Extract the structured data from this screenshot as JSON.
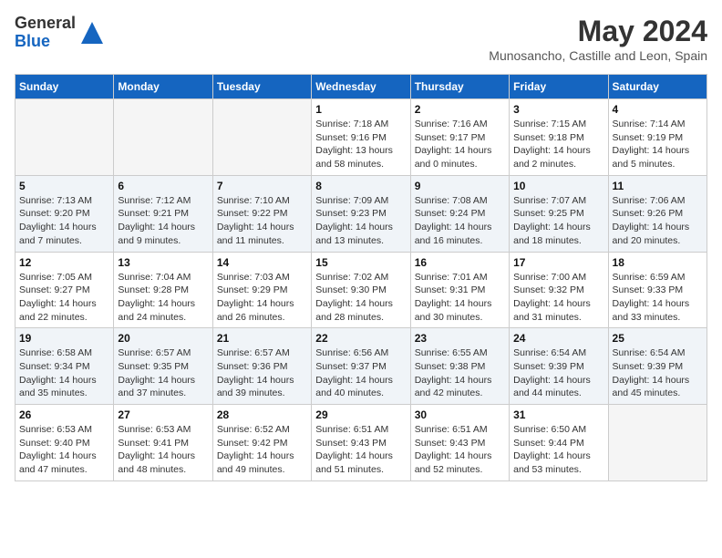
{
  "header": {
    "logo_general": "General",
    "logo_blue": "Blue",
    "month_year": "May 2024",
    "location": "Munosancho, Castille and Leon, Spain"
  },
  "calendar": {
    "days_of_week": [
      "Sunday",
      "Monday",
      "Tuesday",
      "Wednesday",
      "Thursday",
      "Friday",
      "Saturday"
    ],
    "weeks": [
      [
        {
          "day": "",
          "info": ""
        },
        {
          "day": "",
          "info": ""
        },
        {
          "day": "",
          "info": ""
        },
        {
          "day": "1",
          "info": "Sunrise: 7:18 AM\nSunset: 9:16 PM\nDaylight: 13 hours\nand 58 minutes."
        },
        {
          "day": "2",
          "info": "Sunrise: 7:16 AM\nSunset: 9:17 PM\nDaylight: 14 hours\nand 0 minutes."
        },
        {
          "day": "3",
          "info": "Sunrise: 7:15 AM\nSunset: 9:18 PM\nDaylight: 14 hours\nand 2 minutes."
        },
        {
          "day": "4",
          "info": "Sunrise: 7:14 AM\nSunset: 9:19 PM\nDaylight: 14 hours\nand 5 minutes."
        }
      ],
      [
        {
          "day": "5",
          "info": "Sunrise: 7:13 AM\nSunset: 9:20 PM\nDaylight: 14 hours\nand 7 minutes."
        },
        {
          "day": "6",
          "info": "Sunrise: 7:12 AM\nSunset: 9:21 PM\nDaylight: 14 hours\nand 9 minutes."
        },
        {
          "day": "7",
          "info": "Sunrise: 7:10 AM\nSunset: 9:22 PM\nDaylight: 14 hours\nand 11 minutes."
        },
        {
          "day": "8",
          "info": "Sunrise: 7:09 AM\nSunset: 9:23 PM\nDaylight: 14 hours\nand 13 minutes."
        },
        {
          "day": "9",
          "info": "Sunrise: 7:08 AM\nSunset: 9:24 PM\nDaylight: 14 hours\nand 16 minutes."
        },
        {
          "day": "10",
          "info": "Sunrise: 7:07 AM\nSunset: 9:25 PM\nDaylight: 14 hours\nand 18 minutes."
        },
        {
          "day": "11",
          "info": "Sunrise: 7:06 AM\nSunset: 9:26 PM\nDaylight: 14 hours\nand 20 minutes."
        }
      ],
      [
        {
          "day": "12",
          "info": "Sunrise: 7:05 AM\nSunset: 9:27 PM\nDaylight: 14 hours\nand 22 minutes."
        },
        {
          "day": "13",
          "info": "Sunrise: 7:04 AM\nSunset: 9:28 PM\nDaylight: 14 hours\nand 24 minutes."
        },
        {
          "day": "14",
          "info": "Sunrise: 7:03 AM\nSunset: 9:29 PM\nDaylight: 14 hours\nand 26 minutes."
        },
        {
          "day": "15",
          "info": "Sunrise: 7:02 AM\nSunset: 9:30 PM\nDaylight: 14 hours\nand 28 minutes."
        },
        {
          "day": "16",
          "info": "Sunrise: 7:01 AM\nSunset: 9:31 PM\nDaylight: 14 hours\nand 30 minutes."
        },
        {
          "day": "17",
          "info": "Sunrise: 7:00 AM\nSunset: 9:32 PM\nDaylight: 14 hours\nand 31 minutes."
        },
        {
          "day": "18",
          "info": "Sunrise: 6:59 AM\nSunset: 9:33 PM\nDaylight: 14 hours\nand 33 minutes."
        }
      ],
      [
        {
          "day": "19",
          "info": "Sunrise: 6:58 AM\nSunset: 9:34 PM\nDaylight: 14 hours\nand 35 minutes."
        },
        {
          "day": "20",
          "info": "Sunrise: 6:57 AM\nSunset: 9:35 PM\nDaylight: 14 hours\nand 37 minutes."
        },
        {
          "day": "21",
          "info": "Sunrise: 6:57 AM\nSunset: 9:36 PM\nDaylight: 14 hours\nand 39 minutes."
        },
        {
          "day": "22",
          "info": "Sunrise: 6:56 AM\nSunset: 9:37 PM\nDaylight: 14 hours\nand 40 minutes."
        },
        {
          "day": "23",
          "info": "Sunrise: 6:55 AM\nSunset: 9:38 PM\nDaylight: 14 hours\nand 42 minutes."
        },
        {
          "day": "24",
          "info": "Sunrise: 6:54 AM\nSunset: 9:39 PM\nDaylight: 14 hours\nand 44 minutes."
        },
        {
          "day": "25",
          "info": "Sunrise: 6:54 AM\nSunset: 9:39 PM\nDaylight: 14 hours\nand 45 minutes."
        }
      ],
      [
        {
          "day": "26",
          "info": "Sunrise: 6:53 AM\nSunset: 9:40 PM\nDaylight: 14 hours\nand 47 minutes."
        },
        {
          "day": "27",
          "info": "Sunrise: 6:53 AM\nSunset: 9:41 PM\nDaylight: 14 hours\nand 48 minutes."
        },
        {
          "day": "28",
          "info": "Sunrise: 6:52 AM\nSunset: 9:42 PM\nDaylight: 14 hours\nand 49 minutes."
        },
        {
          "day": "29",
          "info": "Sunrise: 6:51 AM\nSunset: 9:43 PM\nDaylight: 14 hours\nand 51 minutes."
        },
        {
          "day": "30",
          "info": "Sunrise: 6:51 AM\nSunset: 9:43 PM\nDaylight: 14 hours\nand 52 minutes."
        },
        {
          "day": "31",
          "info": "Sunrise: 6:50 AM\nSunset: 9:44 PM\nDaylight: 14 hours\nand 53 minutes."
        },
        {
          "day": "",
          "info": ""
        }
      ]
    ]
  }
}
